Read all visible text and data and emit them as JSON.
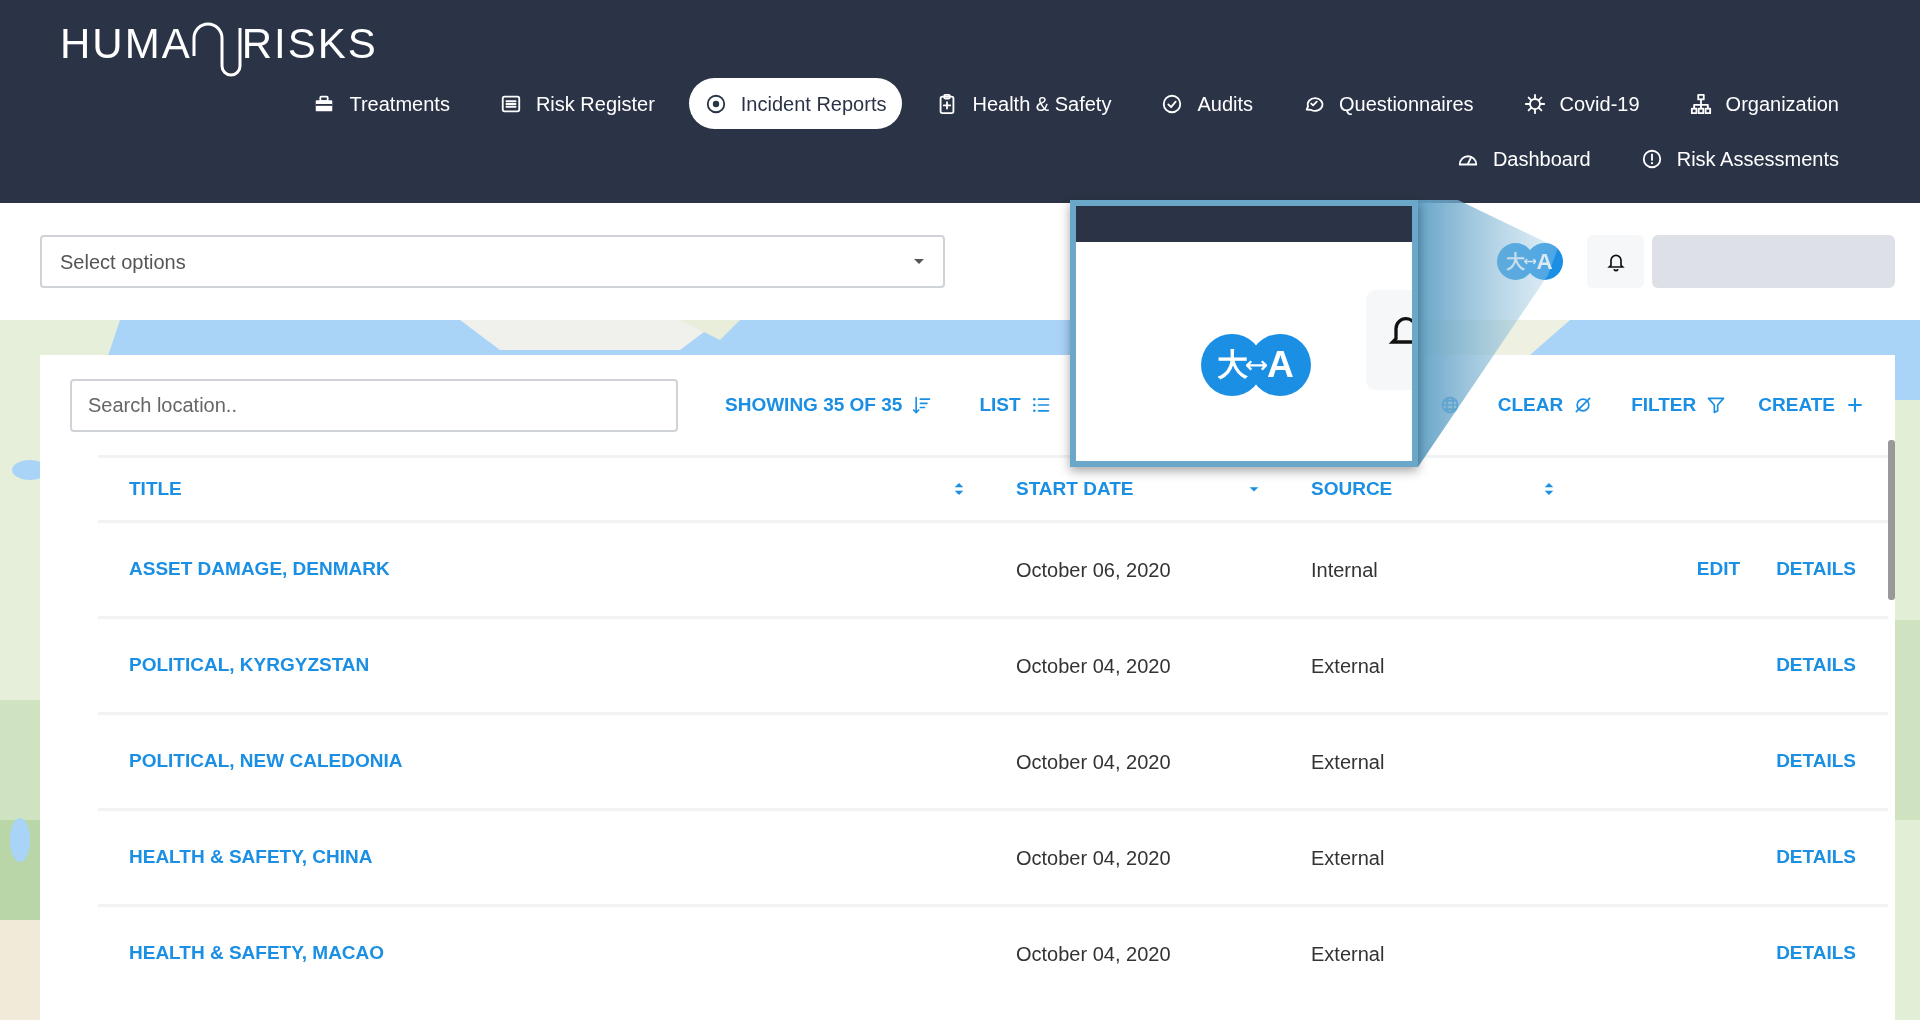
{
  "logo": {
    "left": "HUMA",
    "right": "RISKS"
  },
  "nav": {
    "primary": [
      {
        "label": "Treatments",
        "selected": false
      },
      {
        "label": "Risk Register",
        "selected": false
      },
      {
        "label": "Incident Reports",
        "selected": true
      },
      {
        "label": "Health & Safety",
        "selected": false
      },
      {
        "label": "Audits",
        "selected": false
      },
      {
        "label": "Questionnaires",
        "selected": false
      },
      {
        "label": "Covid-19",
        "selected": false
      },
      {
        "label": "Organization",
        "selected": false
      }
    ],
    "secondary": [
      {
        "label": "Dashboard",
        "selected": false
      },
      {
        "label": "Risk Assessments",
        "selected": false
      }
    ]
  },
  "topbar": {
    "select": {
      "placeholder": "Select options"
    },
    "language_icon": {
      "source": "大",
      "target": "A"
    }
  },
  "toolbar": {
    "search": {
      "placeholder": "Search location.."
    },
    "showing": "SHOWING 35 OF 35",
    "list": "LIST",
    "clear": "CLEAR",
    "filter": "FILTER",
    "create": "CREATE"
  },
  "table": {
    "columns": [
      {
        "label": "TITLE",
        "sorted": false
      },
      {
        "label": "START DATE",
        "sorted": true
      },
      {
        "label": "SOURCE",
        "sorted": false
      }
    ],
    "rows": [
      {
        "title": "ASSET DAMAGE, DENMARK",
        "start_date": "October 06, 2020",
        "source": "Internal",
        "actions": [
          "EDIT",
          "DETAILS"
        ]
      },
      {
        "title": "POLITICAL, KYRGYZSTAN",
        "start_date": "October 04, 2020",
        "source": "External",
        "actions": [
          "DETAILS"
        ]
      },
      {
        "title": "POLITICAL, NEW CALEDONIA",
        "start_date": "October 04, 2020",
        "source": "External",
        "actions": [
          "DETAILS"
        ]
      },
      {
        "title": "HEALTH & SAFETY, CHINA",
        "start_date": "October 04, 2020",
        "source": "External",
        "actions": [
          "DETAILS"
        ]
      },
      {
        "title": "HEALTH & SAFETY, MACAO",
        "start_date": "October 04, 2020",
        "source": "External",
        "actions": [
          "DETAILS"
        ]
      }
    ]
  },
  "callout": {
    "language_icon": {
      "source": "大",
      "target": "A"
    }
  }
}
